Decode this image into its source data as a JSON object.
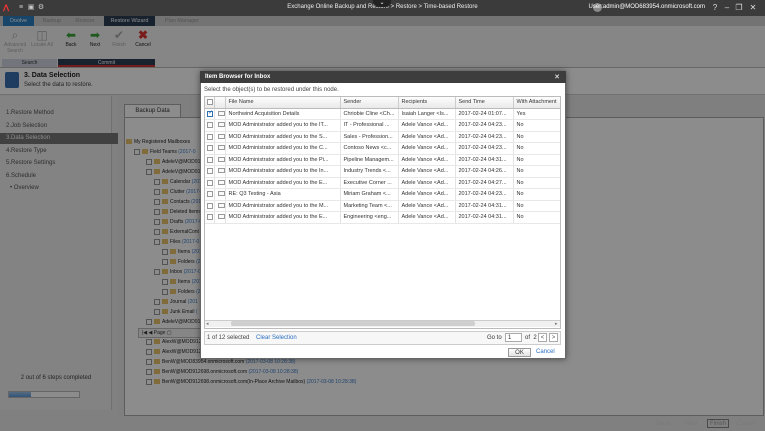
{
  "titlebar": {
    "title": "Exchange Online Backup and Restore > Restore > Time-based Restore",
    "user": "User:admin@MOD683954.onmicrosoft.com"
  },
  "tabs": [
    "Doolve",
    "Backup",
    "Restore",
    "Restore Wizard",
    "Plan Manager"
  ],
  "ribbon": {
    "buttons": [
      "Advanced Search",
      "Locate All",
      "Back",
      "Next",
      "Finish",
      "Cancel"
    ],
    "groups": [
      "Search",
      "Commit"
    ]
  },
  "step": {
    "title": "3. Data Selection",
    "desc": "Select the data to restore."
  },
  "nav": [
    "1.Restore Method",
    "2.Job Selection",
    "3.Data Selection",
    "4.Restore Type",
    "5.Restore Settings",
    "6.Schedule",
    "Overview"
  ],
  "progress": {
    "text": "2 out of 6 steps completed",
    "fraction": 0.33
  },
  "main": {
    "tab": "Backup Data"
  },
  "tree": [
    {
      "label": "My Registered Mailboxes",
      "ts": ""
    },
    {
      "label": "Field Teams",
      "ts": "(2017-0"
    },
    {
      "label": "AdeleV@MOD91",
      "ts": ""
    },
    {
      "label": "AdeleV@MOD91",
      "ts": ""
    },
    {
      "label": "Calendar",
      "ts": "(2017"
    },
    {
      "label": "Clutter",
      "ts": "(2017-0"
    },
    {
      "label": "Contacts",
      "ts": "(2017"
    },
    {
      "label": "Deleted Items",
      "ts": ""
    },
    {
      "label": "Drafts",
      "ts": "(2017-0"
    },
    {
      "label": "ExternalCont",
      "ts": ""
    },
    {
      "label": "Files",
      "ts": "(2017-0"
    },
    {
      "label": "Items",
      "ts": "(201"
    },
    {
      "label": "Folders",
      "ts": "(201"
    },
    {
      "label": "Inbox",
      "ts": "(2017-0"
    },
    {
      "label": "Items",
      "ts": "(201"
    },
    {
      "label": "Folders",
      "ts": "(201"
    },
    {
      "label": "Journal",
      "ts": "(201"
    },
    {
      "label": "Junk Email",
      "ts": "("
    },
    {
      "label": "AdeleV@MOD912698.onmicrosoft.com",
      "ts": ""
    },
    {
      "label": "AlexW@MOD91",
      "ts": ""
    },
    {
      "label": "AlexW@MOD912698.onmicrosoft.com",
      "ts": "(2017-03-08 10:28:38)"
    },
    {
      "label": "AlexW@MOD912698.onmicrosoft.com(In-Place Archive Mailbox)",
      "ts": "(2017-03-08 10:28:38)"
    },
    {
      "label": "BenW@MOD83954.onmicrosoft.com",
      "ts": "(2017-03-08 10:28:38)"
    },
    {
      "label": "BenW@MOD912698.onmicrosoft.com",
      "ts": "(2017-03-08 10:28:38)"
    },
    {
      "label": "BenW@MOD912698.onmicrosoft.com(In-Place Archive Mailbox)",
      "ts": "(2017-03-08 10:28:38)"
    }
  ],
  "pager": {
    "label": "Page"
  },
  "dialog": {
    "title": "Item Browser for Inbox",
    "instruction": "Select the object(s) to be restored under this node.",
    "columns": [
      "File Name",
      "Sender",
      "Recipients",
      "Send Time",
      "With Attachment"
    ],
    "rows": [
      {
        "checked": true,
        "name": "Northwind Acquisition Details",
        "sender": "Chriobie Cline <Ch...",
        "recipients": "Isaiah Langer <Is...",
        "time": "2017-02-24 01:07...",
        "att": "Yes"
      },
      {
        "checked": false,
        "name": "MOD Administrator added you to the IT...",
        "sender": "IT - Professional ...",
        "recipients": "Adele Vance <Ad...",
        "time": "2017-02-24 04:23...",
        "att": "No"
      },
      {
        "checked": false,
        "name": "MOD Administrator added you to the S...",
        "sender": "Sales - Profession...",
        "recipients": "Adele Vance <Ad...",
        "time": "2017-02-24 04:23...",
        "att": "No"
      },
      {
        "checked": false,
        "name": "MOD Administrator added you to the C...",
        "sender": "Contoso News <c...",
        "recipients": "Adele Vance <Ad...",
        "time": "2017-02-24 04:23...",
        "att": "No"
      },
      {
        "checked": false,
        "name": "MOD Administrator added you to the Pi...",
        "sender": "Pipeline Managem...",
        "recipients": "Adele Vance <Ad...",
        "time": "2017-02-24 04:31...",
        "att": "No"
      },
      {
        "checked": false,
        "name": "MOD Administrator added you to the In...",
        "sender": "Industry Trends <...",
        "recipients": "Adele Vance <Ad...",
        "time": "2017-02-24 04:26...",
        "att": "No"
      },
      {
        "checked": false,
        "name": "MOD Administrator added you to the E...",
        "sender": "Executive Corner ...",
        "recipients": "Adele Vance <Ad...",
        "time": "2017-02-24 04:27...",
        "att": "No"
      },
      {
        "checked": false,
        "name": "RE: Q3 Testing - Asia",
        "sender": "Miriam Graham <...",
        "recipients": "Adele Vance <Ad...",
        "time": "2017-02-24 04:23...",
        "att": "No"
      },
      {
        "checked": false,
        "name": "MOD Administrator added you to the M...",
        "sender": "Marketing Team <...",
        "recipients": "Adele Vance <Ad...",
        "time": "2017-02-24 04:31...",
        "att": "No"
      },
      {
        "checked": false,
        "name": "MOD Administrator added you to the E...",
        "sender": "Engineering <eng...",
        "recipients": "Adele Vance <Ad...",
        "time": "2017-02-24 04:31...",
        "att": "No"
      }
    ],
    "selcount": "1 of 12 selected",
    "clear": "Clear Selection",
    "goto": "Go to",
    "page": "1",
    "of": "of",
    "pages": "2",
    "ok": "OK",
    "cancel": "Cancel"
  },
  "bottom": [
    "Back",
    "Next",
    "Finish",
    "Cancel"
  ]
}
